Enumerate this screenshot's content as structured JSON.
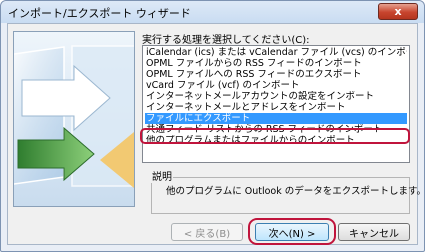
{
  "window": {
    "title": "インポート/エクスポート ウィザード",
    "close_glyph": "x"
  },
  "wizard": {
    "prompt": "実行する処理を選択してください(C):",
    "actions": [
      "iCalendar (ics) または vCalendar ファイル (vcs) のインポート",
      "OPML ファイルからの RSS フィードのインポート",
      "OPML ファイルへの RSS フィードのエクスポート",
      "vCard ファイル (vcf) のインポート",
      "インターネットメールアカウントの設定をインポート",
      "インターネットメールとアドレスをインポート",
      "ファイルにエクスポート",
      "共通フィード リストからの RSS フィードのインポート",
      "他のプログラムまたはファイルからのインポート"
    ],
    "selected_index": 6,
    "description_label": "説明",
    "description_text": "他のプログラムに Outlook のデータをエクスポートします。"
  },
  "buttons": {
    "back": "< 戻る(B)",
    "next": "次へ(N) >",
    "cancel": "キャンセル"
  },
  "colors": {
    "selection": "#3399ff",
    "highlight_ring": "#c0143c"
  }
}
